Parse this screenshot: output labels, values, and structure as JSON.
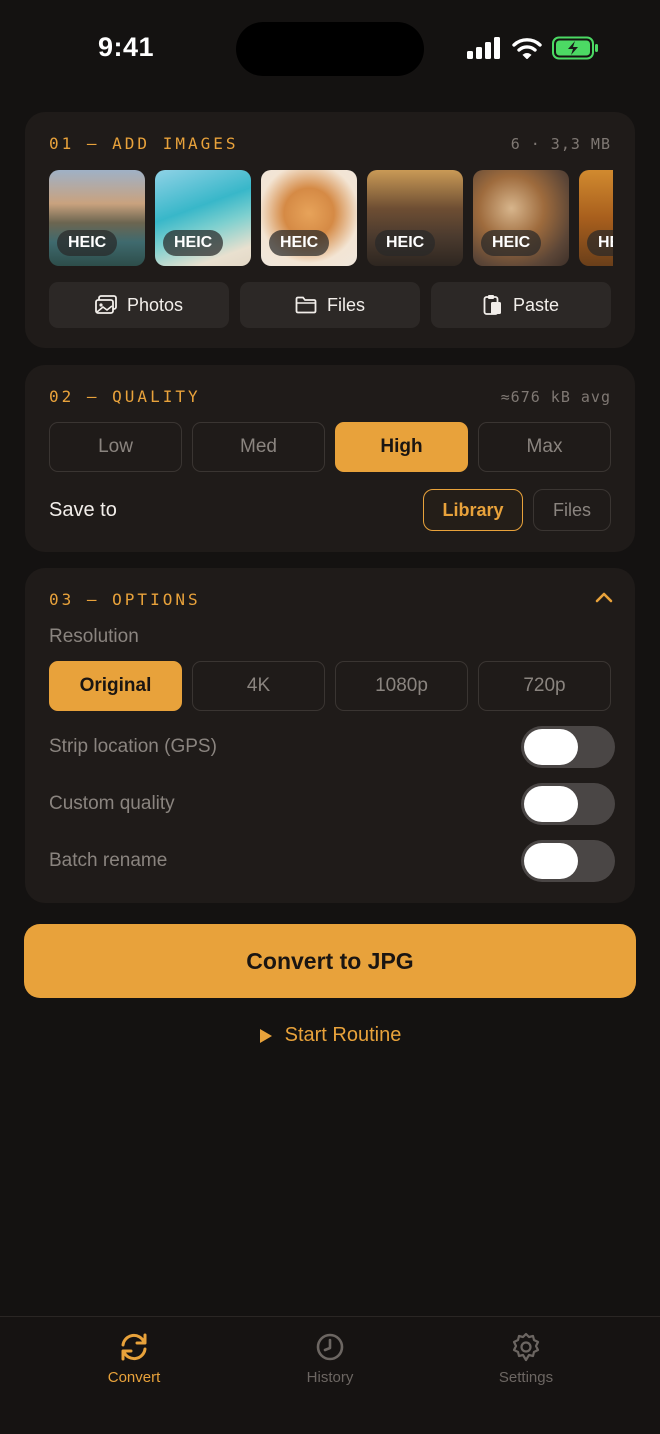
{
  "status_bar": {
    "time": "9:41"
  },
  "colors": {
    "accent": "#e8a23b",
    "background": "#141211",
    "card": "#1f1b19"
  },
  "add_images": {
    "title": "01 — ADD IMAGES",
    "meta": "6 · 3,3 MB",
    "thumbnails": [
      {
        "format": "HEIC",
        "subject": "mountain lake"
      },
      {
        "format": "HEIC",
        "subject": "beach"
      },
      {
        "format": "HEIC",
        "subject": "kitten"
      },
      {
        "format": "HEIC",
        "subject": "city street"
      },
      {
        "format": "HEIC",
        "subject": "breakfast"
      },
      {
        "format": "HEIC",
        "subject": "autumn"
      }
    ],
    "buttons": {
      "photos": "Photos",
      "files": "Files",
      "paste": "Paste"
    }
  },
  "quality": {
    "title": "02 — QUALITY",
    "meta": "≈676 kB avg",
    "options": [
      "Low",
      "Med",
      "High",
      "Max"
    ],
    "selected": "High",
    "save_to_label": "Save to",
    "save_options": [
      "Library",
      "Files"
    ],
    "save_selected": "Library"
  },
  "options": {
    "title": "03 — OPTIONS",
    "resolution_label": "Resolution",
    "resolutions": [
      "Original",
      "4K",
      "1080p",
      "720p"
    ],
    "resolution_selected": "Original",
    "toggles": [
      {
        "label": "Strip location (GPS)",
        "on": false
      },
      {
        "label": "Custom quality",
        "on": false
      },
      {
        "label": "Batch rename",
        "on": false
      }
    ]
  },
  "convert_button": "Convert to JPG",
  "routine_button": "Start Routine",
  "tabs": [
    {
      "label": "Convert",
      "icon": "refresh-icon",
      "active": true
    },
    {
      "label": "History",
      "icon": "clock-icon",
      "active": false
    },
    {
      "label": "Settings",
      "icon": "gear-icon",
      "active": false
    }
  ]
}
